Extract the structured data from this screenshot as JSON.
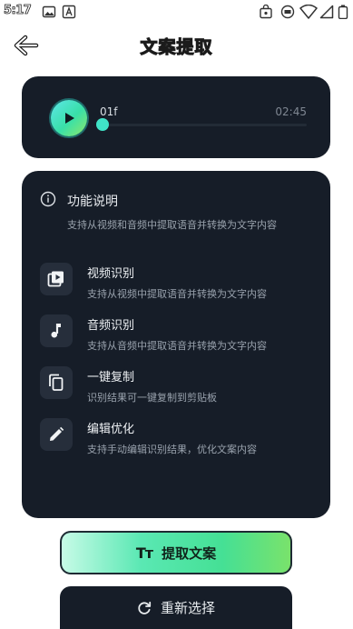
{
  "status_bar": {
    "time": "5:17",
    "icons": [
      "gallery-icon",
      "a-notification-icon",
      "bag-icon",
      "vpn-icon",
      "wifi-icon",
      "signal-icon",
      "battery-icon"
    ]
  },
  "header": {
    "title": "文案提取",
    "back_icon": "arrow-left-icon"
  },
  "player": {
    "track_name": "01f",
    "duration": "02:45",
    "progress": 0.0,
    "play_icon": "play-icon"
  },
  "info": {
    "title": "功能说明",
    "description": "支持从视频和音频中提取语音并转换为文字内容",
    "features": [
      {
        "icon": "video-file-icon",
        "title": "视频识别",
        "desc": "支持从视频中提取语音并转换为文字内容"
      },
      {
        "icon": "music-note-icon",
        "title": "音频识别",
        "desc": "支持从音频中提取语音并转换为文字内容"
      },
      {
        "icon": "copy-icon",
        "title": "一键复制",
        "desc": "识别结果可一键复制到剪贴板"
      },
      {
        "icon": "edit-pencil-icon",
        "title": "编辑优化",
        "desc": "支持手动编辑识别结果，优化文案内容"
      }
    ]
  },
  "actions": {
    "extract_icon_text": "Tт",
    "extract_label": "提取文案",
    "reselect_label": "重新选择"
  },
  "colors": {
    "card_bg": "#161d28",
    "accent_teal": "#40e3c7",
    "accent_green": "#45e095"
  }
}
